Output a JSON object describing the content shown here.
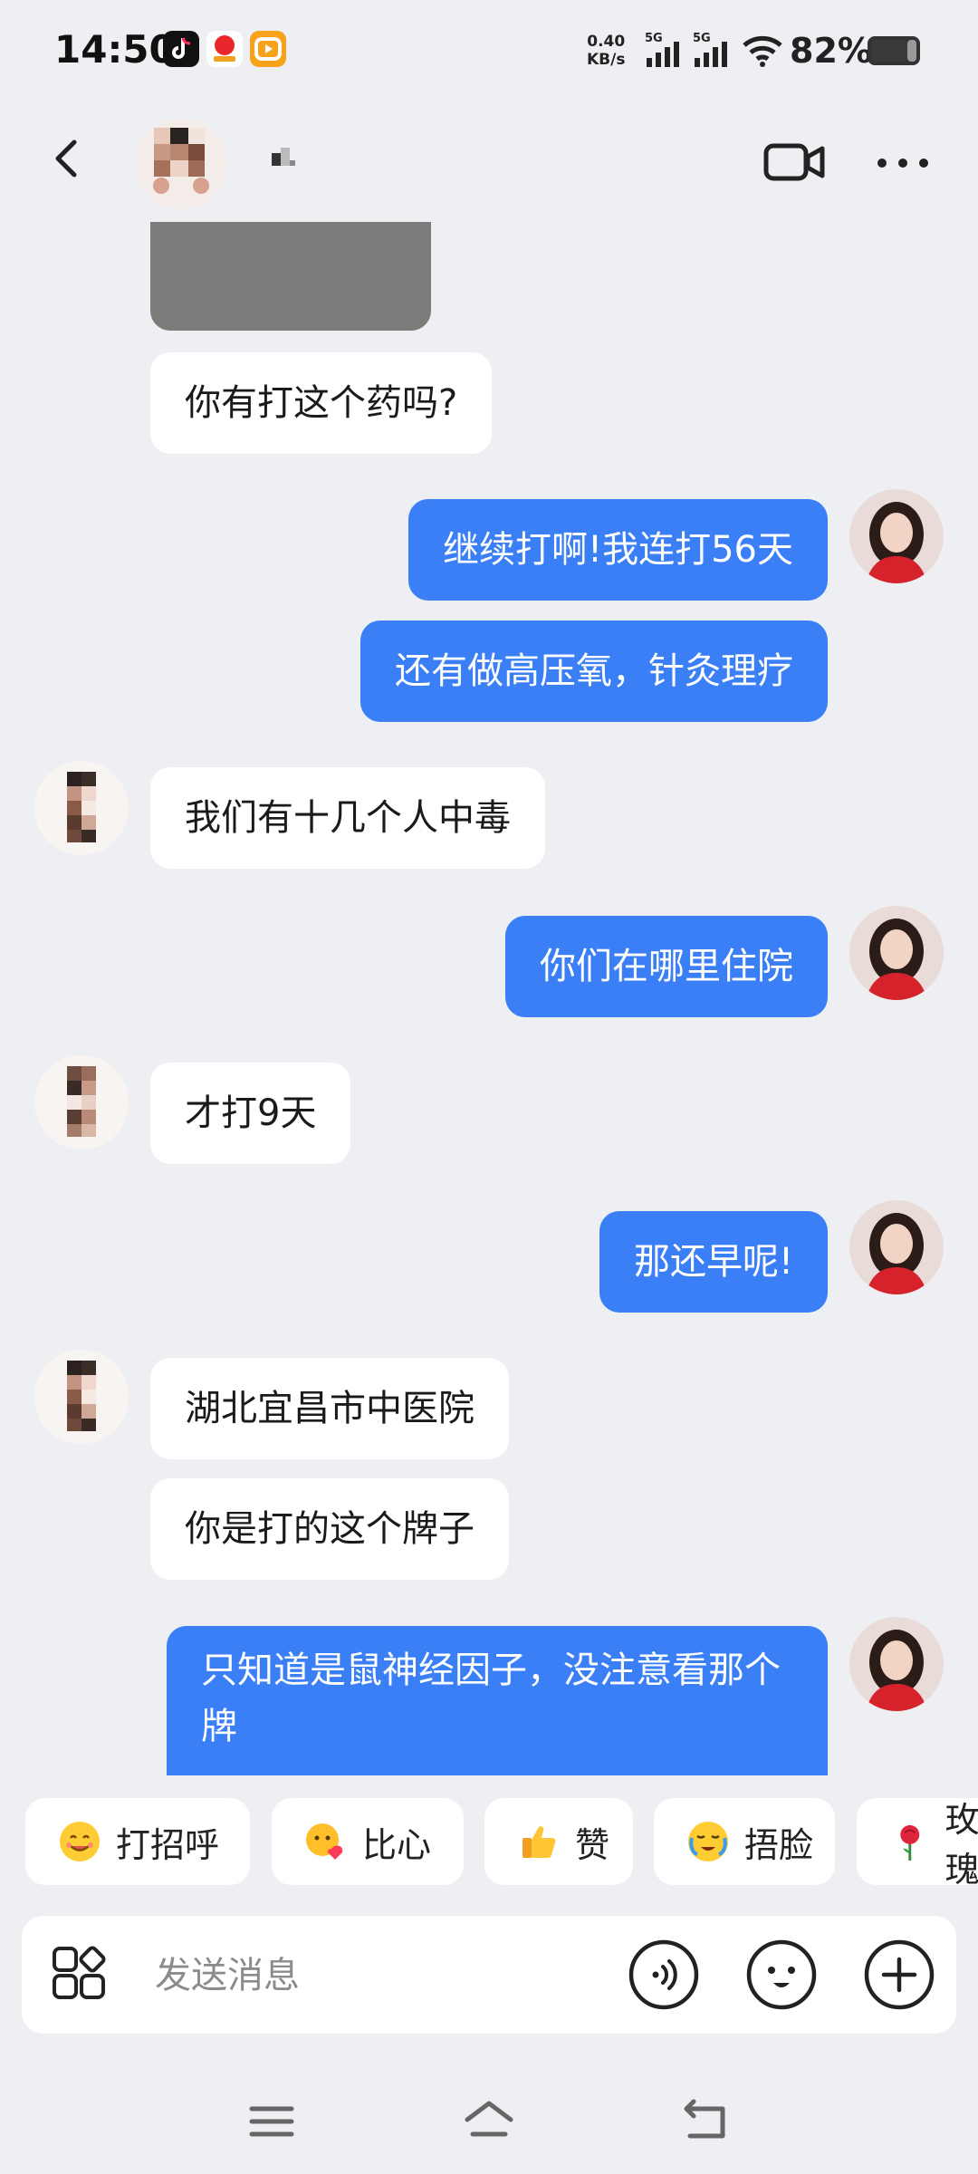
{
  "status_bar": {
    "time": "14:50",
    "net_speed_value": "0.40",
    "net_speed_unit": "KB/s",
    "signal1": "5G",
    "signal2": "5G",
    "battery": "82%"
  },
  "header": {
    "contact_name": "",
    "icons": [
      "back-icon",
      "video-call-icon",
      "more-icon"
    ]
  },
  "messages": [
    {
      "side": "in",
      "text": "你有打这个药吗?"
    },
    {
      "side": "out",
      "text": "继续打啊!我连打56天"
    },
    {
      "side": "out",
      "text": "还有做高压氧，针灸理疗"
    },
    {
      "side": "in",
      "text": "我们有十几个人中毒"
    },
    {
      "side": "out",
      "text": "你们在哪里住院"
    },
    {
      "side": "in",
      "text": "才打9天"
    },
    {
      "side": "out",
      "text": "那还早呢!"
    },
    {
      "side": "in",
      "text": "湖北宜昌市中医院"
    },
    {
      "side": "in",
      "text": "你是打的这个牌子"
    },
    {
      "side": "out",
      "text": "只知道是鼠神经因子，没注意看那个牌"
    }
  ],
  "quick_replies": [
    {
      "label": "打招呼",
      "icon": "smile-emoji-icon"
    },
    {
      "label": "比心",
      "icon": "heart-hands-emoji-icon"
    },
    {
      "label": "赞",
      "icon": "thumbs-up-emoji-icon"
    },
    {
      "label": "捂脸",
      "icon": "facepalm-emoji-icon"
    },
    {
      "label": "玫瑰",
      "icon": "rose-emoji-icon"
    }
  ],
  "input": {
    "placeholder": "发送消息"
  },
  "colors": {
    "outgoing_bubble": "#3a7ff6",
    "incoming_bubble": "#ffffff",
    "background": "#eeeff2"
  }
}
